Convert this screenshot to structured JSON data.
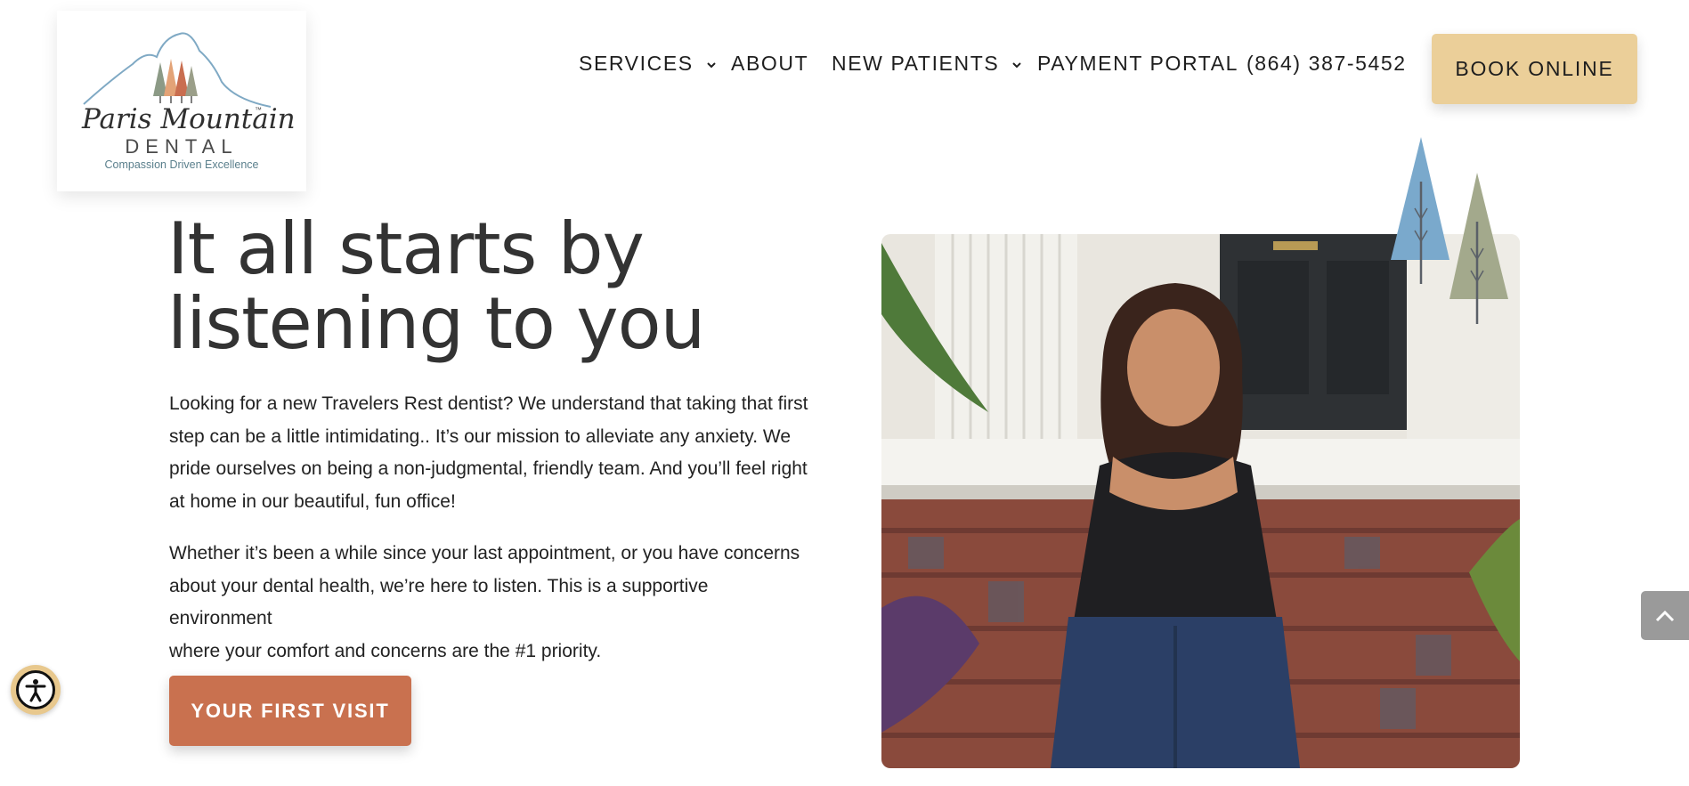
{
  "logo": {
    "script_name": "Paris Mountain",
    "tm": "™",
    "name": "DENTAL",
    "tagline": "Compassion Driven Excellence"
  },
  "nav": {
    "services": "SERVICES",
    "about": "ABOUT",
    "new_patients": "NEW PATIENTS",
    "payment_portal": "PAYMENT PORTAL",
    "phone": "(864) 387-5452",
    "book_online": "BOOK ONLINE"
  },
  "hero": {
    "title_line1": "It all starts by",
    "title_line2": "listening to you",
    "paragraph1_lines": [
      "Looking for a new Travelers Rest dentist? We understand that taking that first",
      "step can be a little intimidating.. It’s our mission to alleviate any anxiety. We",
      "pride ourselves on being a non-judgmental, friendly team. And you’ll feel right",
      "at home in our beautiful, fun office!"
    ],
    "paragraph2_lines": [
      "Whether it’s been a while since your last appointment, or you have concerns",
      "about your dental health, we’re here to listen. This is a supportive environment",
      "where your comfort and concerns are the #1 priority."
    ],
    "cta": "YOUR FIRST VISIT"
  },
  "icons": {
    "chevron": "chevron-down-icon",
    "scroll_top": "chevron-up-icon",
    "accessibility": "accessibility-icon"
  },
  "colors": {
    "book_button": "#ebcf99",
    "cta_button": "#c9714f",
    "tree_blue": "#7aa9cc",
    "tree_sage": "#a3a98c",
    "scroll_button": "#9a9a9a"
  }
}
